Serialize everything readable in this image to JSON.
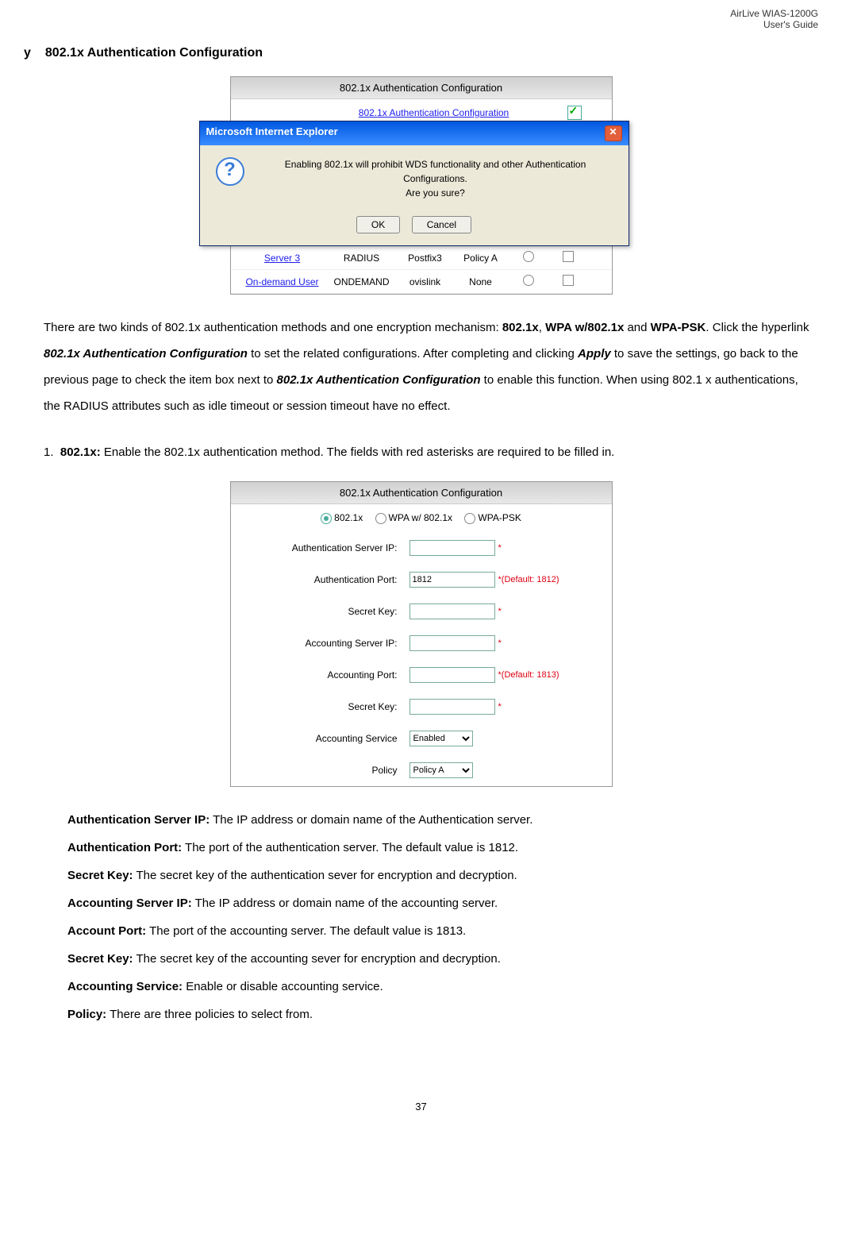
{
  "header": {
    "line1": "AirLive WIAS-1200G",
    "line2": "User's Guide"
  },
  "section": {
    "bullet": "y",
    "title": "802.1x Authentication Configuration"
  },
  "screenshot1": {
    "config_title": "802.1x Authentication Configuration",
    "config_link": "802.1x Authentication Configuration",
    "dialog": {
      "title": "Microsoft Internet Explorer",
      "message_line1": "Enabling 802.1x will prohibit WDS functionality and other Authentication Configurations.",
      "message_line2": "Are you sure?",
      "ok": "OK",
      "cancel": "Cancel"
    },
    "rows": [
      {
        "server": "Server 3",
        "type": "RADIUS",
        "postfix": "Postfix3",
        "policy": "Policy A"
      },
      {
        "server": "On-demand User",
        "type": "ONDEMAND",
        "postfix": "ovislink",
        "policy": "None"
      }
    ]
  },
  "body_text": {
    "p1_part1": "There are two kinds of 802.1x authentication methods and one encryption mechanism: ",
    "p1_bold1": "802.1x",
    "p1_comma": ", ",
    "p1_bold2": "WPA w/802.1x",
    "p1_part2": " and ",
    "p1_bold3": "WPA-PSK",
    "p1_part3": ". Click the hyperlink ",
    "p1_italic1": "802.1x Authentication Configuration",
    "p1_part4": " to set the related configurations. After completing and clicking ",
    "p1_italic2": "Apply",
    "p1_part5": " to save the settings, go back to the previous page to check the item box next to ",
    "p1_italic3": "802.1x Authentication Configuration",
    "p1_part6": " to enable this function. When using 802.1 x authentications, the RADIUS attributes such as idle timeout or session timeout have no effect.",
    "list1_num": "1.",
    "list1_bold": "802.1x:",
    "list1_text": " Enable the 802.1x authentication method. The fields with red asterisks are required to be filled in."
  },
  "screenshot2": {
    "title": "802.1x Authentication Configuration",
    "radio1": "802.1x",
    "radio2": "WPA w/ 802.1x",
    "radio3": "WPA-PSK",
    "fields": [
      {
        "label": "Authentication Server IP:",
        "value": "",
        "hint": "*"
      },
      {
        "label": "Authentication Port:",
        "value": "1812",
        "hint": "*(Default: 1812)"
      },
      {
        "label": "Secret Key:",
        "value": "",
        "hint": "*"
      },
      {
        "label": "Accounting Server IP:",
        "value": "",
        "hint": "*"
      },
      {
        "label": "Accounting Port:",
        "value": "",
        "hint": "*(Default: 1813)"
      },
      {
        "label": "Secret Key:",
        "value": "",
        "hint": "*"
      }
    ],
    "select_fields": [
      {
        "label": "Accounting Service",
        "value": "Enabled"
      },
      {
        "label": "Policy",
        "value": "Policy A"
      }
    ]
  },
  "definitions": [
    {
      "term": "Authentication Server IP:",
      "desc": " The IP address or domain name of the Authentication server."
    },
    {
      "term": "Authentication Port:",
      "desc": " The port of the authentication server. The default value is 1812."
    },
    {
      "term": "Secret Key:",
      "desc": " The secret key of the authentication sever for encryption and decryption."
    },
    {
      "term": "Accounting Server IP:",
      "desc": " The IP address or domain name of the accounting server."
    },
    {
      "term": "Account Port:",
      "desc": " The port of the accounting server. The default value is 1813."
    },
    {
      "term": "Secret Key:",
      "desc": " The secret key of the accounting sever for encryption and decryption."
    },
    {
      "term": "Accounting Service:",
      "desc": " Enable or disable accounting service."
    },
    {
      "term": "Policy:",
      "desc": " There are three policies to select from."
    }
  ],
  "page_num": "37"
}
